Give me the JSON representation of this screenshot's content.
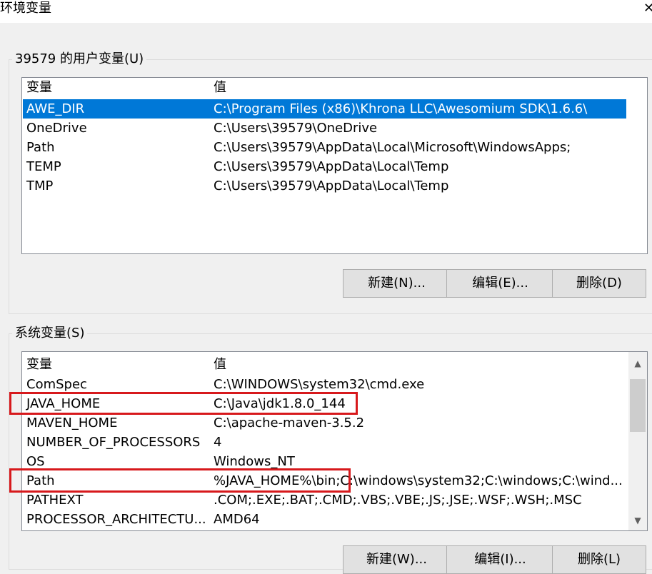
{
  "window": {
    "title": "环境变量",
    "close_glyph": "✕"
  },
  "user_vars": {
    "group_label": "39579 的用户变量(U)",
    "header": {
      "name": "变量",
      "value": "值"
    },
    "rows": [
      {
        "name": "AWE_DIR",
        "value": "C:\\Program Files (x86)\\Khrona LLC\\Awesomium SDK\\1.6.6\\"
      },
      {
        "name": "OneDrive",
        "value": "C:\\Users\\39579\\OneDrive"
      },
      {
        "name": "Path",
        "value": "C:\\Users\\39579\\AppData\\Local\\Microsoft\\WindowsApps;"
      },
      {
        "name": "TEMP",
        "value": "C:\\Users\\39579\\AppData\\Local\\Temp"
      },
      {
        "name": "TMP",
        "value": "C:\\Users\\39579\\AppData\\Local\\Temp"
      }
    ],
    "selected_row": "AWE_DIR",
    "buttons": {
      "new": "新建(N)...",
      "edit": "编辑(E)...",
      "delete": "删除(D)"
    }
  },
  "system_vars": {
    "group_label": "系统变量(S)",
    "header": {
      "name": "变量",
      "value": "值"
    },
    "rows": [
      {
        "name": "ComSpec",
        "value": "C:\\WINDOWS\\system32\\cmd.exe"
      },
      {
        "name": "JAVA_HOME",
        "value": "C:\\Java\\jdk1.8.0_144"
      },
      {
        "name": "MAVEN_HOME",
        "value": "C:\\apache-maven-3.5.2"
      },
      {
        "name": "NUMBER_OF_PROCESSORS",
        "value": "4"
      },
      {
        "name": "OS",
        "value": "Windows_NT"
      },
      {
        "name": "Path",
        "value": "%JAVA_HOME%\\bin;C:\\windows\\system32;C:\\windows;C:\\wind..."
      },
      {
        "name": "PATHEXT",
        "value": ".COM;.EXE;.BAT;.CMD;.VBS;.VBE;.JS;.JSE;.WSF;.WSH;.MSC"
      },
      {
        "name": "PROCESSOR_ARCHITECTU...",
        "value": "AMD64"
      }
    ],
    "highlighted_rows": [
      "JAVA_HOME",
      "Path"
    ],
    "highlight_color": "#d7191c",
    "buttons": {
      "new": "新建(W)...",
      "edit": "编辑(I)...",
      "delete": "删除(L)"
    },
    "scroll": {
      "up_icon": "▲",
      "down_icon": "▼"
    }
  },
  "colors": {
    "selection": "#0078d7",
    "dialog_bg": "#f0f0f0"
  }
}
